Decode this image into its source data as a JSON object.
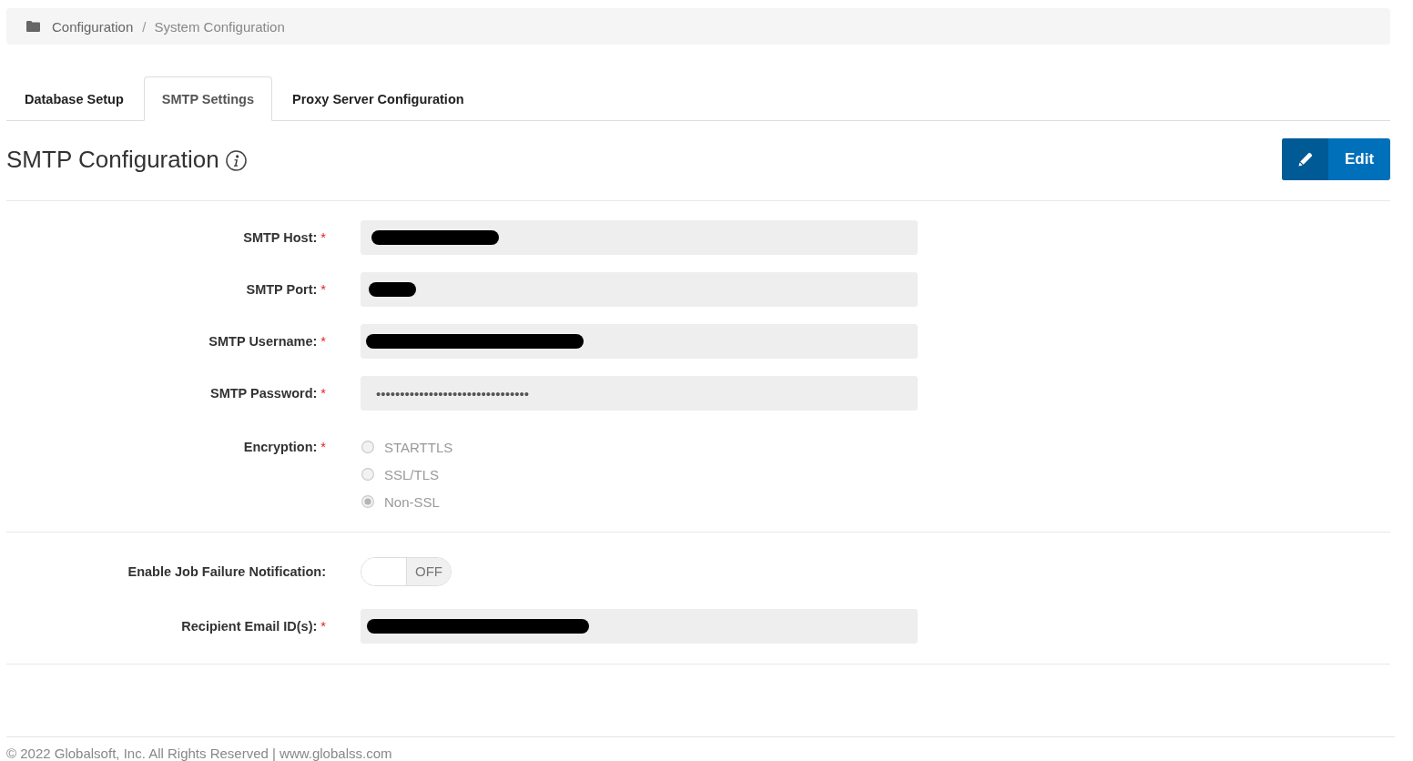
{
  "breadcrumb": {
    "items": [
      {
        "label": "Configuration"
      },
      {
        "label": "System Configuration"
      }
    ],
    "separator": "/"
  },
  "tabs": [
    {
      "label": "Database Setup",
      "selected": false
    },
    {
      "label": "SMTP Settings",
      "selected": true
    },
    {
      "label": "Proxy Server Configuration",
      "selected": false
    }
  ],
  "section": {
    "title": "SMTP Configuration",
    "edit_button": "Edit"
  },
  "groups": [
    {
      "rows": [
        {
          "kind": "text",
          "label": "SMTP Host:",
          "required_mark": "*",
          "disabled": true,
          "redacted": true
        },
        {
          "kind": "text",
          "label": "SMTP Port:",
          "required_mark": "*",
          "disabled": true,
          "redacted": true
        },
        {
          "kind": "text",
          "label": "SMTP Username:",
          "required_mark": "*",
          "disabled": true,
          "redacted": true
        },
        {
          "kind": "password",
          "label": "SMTP Password:",
          "required_mark": "*",
          "disabled": true,
          "value": "••••••••••••••••••••••••••••••••"
        },
        {
          "kind": "radio",
          "label": "Encryption:",
          "required_mark": "*",
          "disabled": true,
          "options": [
            {
              "label": "STARTTLS",
              "selected": false
            },
            {
              "label": "SSL/TLS",
              "selected": false
            },
            {
              "label": "Non-SSL",
              "selected": true
            }
          ]
        }
      ]
    },
    {
      "rows": [
        {
          "kind": "toggle",
          "label": "Enable Job Failure Notification:",
          "on": false,
          "state_label": "OFF"
        },
        {
          "kind": "text",
          "label": "Recipient Email ID(s):",
          "required_mark": "*",
          "disabled": true,
          "redacted": true
        }
      ]
    }
  ],
  "footer": {
    "text": "© 2022 Globalsoft, Inc. All Rights Reserved | www.globalss.com"
  }
}
